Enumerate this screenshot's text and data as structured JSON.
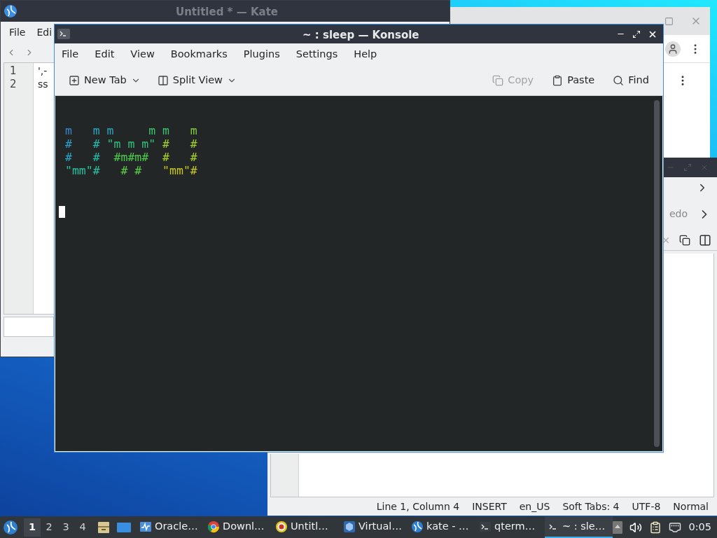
{
  "kate_window": {
    "title": "Untitled * — Kate",
    "menu": [
      "File",
      "Edi"
    ],
    "lines": [
      {
        "number": "1",
        "text": "',-"
      },
      {
        "number": "2",
        "text": "ss"
      }
    ]
  },
  "editor_window": {
    "toolbar_text": "edo",
    "status_bar": [
      "Line 1, Column 4",
      "INSERT",
      "en_US",
      "Soft Tabs: 4",
      "UTF-8",
      "Normal"
    ]
  },
  "konsole": {
    "title": "~ : sleep — Konsole",
    "menu": [
      "File",
      "Edit",
      "View",
      "Bookmarks",
      "Plugins",
      "Settings",
      "Help"
    ],
    "toolbar": [
      {
        "kind": "new-tab",
        "label": "New Tab",
        "dropdown": true,
        "disabled": false
      },
      {
        "kind": "split-view",
        "label": "Split View",
        "dropdown": true,
        "disabled": false
      },
      {
        "kind": "copy",
        "label": "Copy",
        "dropdown": false,
        "disabled": true
      },
      {
        "kind": "paste",
        "label": "Paste",
        "dropdown": false,
        "disabled": false
      },
      {
        "kind": "find",
        "label": "Find",
        "dropdown": false,
        "disabled": false
      }
    ],
    "terminal_lines": [
      {
        "segments": [
          {
            "text": "m",
            "color": "#3a86c8"
          },
          {
            "text": "   m m",
            "color": "#2aa7c0"
          },
          {
            "text": "     m m",
            "color": "#3cc56a"
          },
          {
            "text": "   m",
            "color": "#7ccf3a"
          }
        ]
      },
      {
        "segments": [
          {
            "text": "#",
            "color": "#2a9fd0"
          },
          {
            "text": "   # ",
            "color": "#22b8b0"
          },
          {
            "text": "\"m m m\"",
            "color": "#33c07a"
          },
          {
            "text": " #   #",
            "color": "#9fd030"
          }
        ]
      },
      {
        "segments": [
          {
            "text": "#",
            "color": "#25a8c8"
          },
          {
            "text": "   #",
            "color": "#22bba8"
          },
          {
            "text": "  #m#m#",
            "color": "#4cc84a"
          },
          {
            "text": "  #   #",
            "color": "#a8d028"
          }
        ]
      },
      {
        "segments": [
          {
            "text": "\"mm\"#",
            "color": "#28c0a0"
          },
          {
            "text": "   # #",
            "color": "#5ccc40"
          },
          {
            "text": "   \"mm\"#",
            "color": "#c8c820"
          }
        ]
      }
    ]
  },
  "taskbar": {
    "desktops": [
      {
        "label": "1",
        "selected": true
      },
      {
        "label": "2",
        "selected": false
      },
      {
        "label": "3",
        "selected": false
      },
      {
        "label": "4",
        "selected": false
      }
    ],
    "tasks": [
      {
        "kind": "monitor",
        "label": "Oracle…",
        "selected": false
      },
      {
        "kind": "browser",
        "label": "Downl…",
        "selected": false
      },
      {
        "kind": "record",
        "label": "Untitl…",
        "selected": false
      },
      {
        "kind": "vm",
        "label": "Virtual…",
        "selected": false
      },
      {
        "kind": "kate",
        "label": "kate - …",
        "selected": false
      },
      {
        "kind": "terminal",
        "label": "qterm…",
        "selected": false
      },
      {
        "kind": "terminal",
        "label": "~ : sle…",
        "selected": true
      }
    ],
    "clock": "0:05"
  }
}
